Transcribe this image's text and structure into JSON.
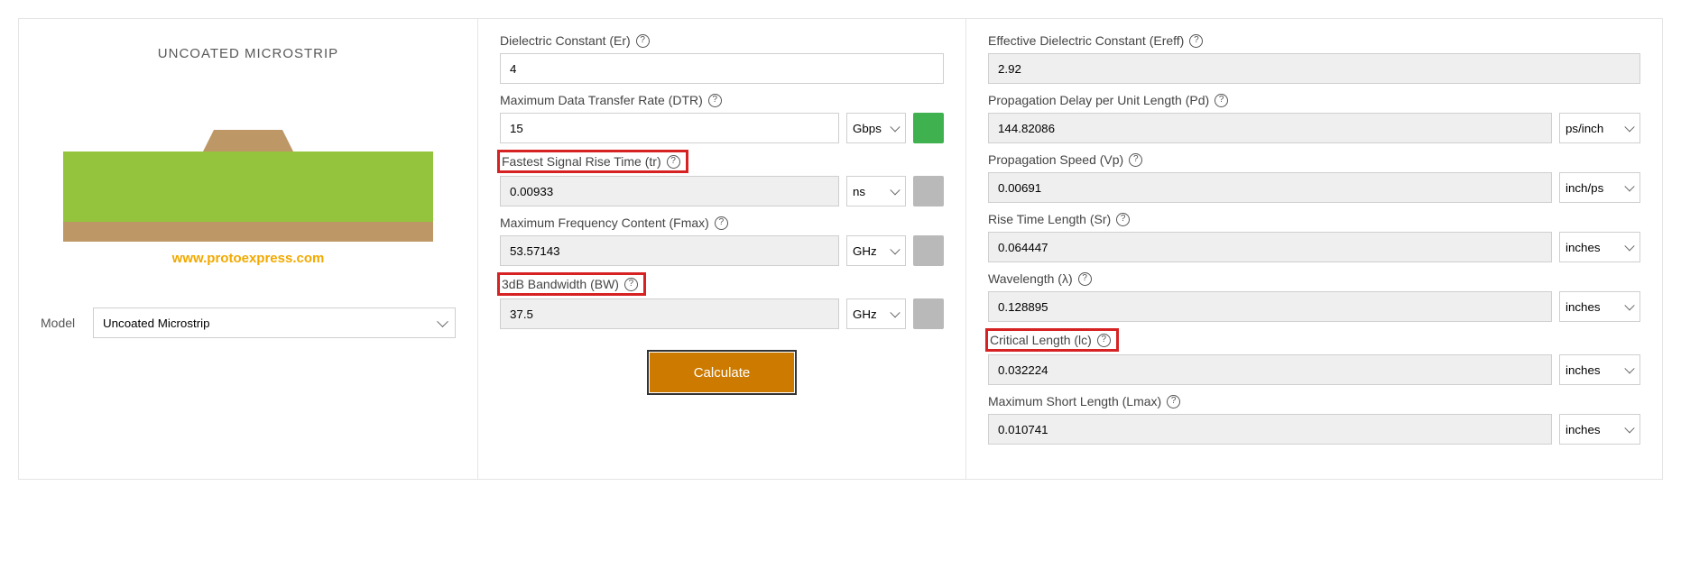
{
  "title": "UNCOATED MICROSTRIP",
  "diagram_url": "www.protoexpress.com",
  "model_label": "Model",
  "model_value": "Uncoated Microstrip",
  "calculate_label": "Calculate",
  "inputs": {
    "er": {
      "label": "Dielectric Constant (Er)",
      "value": "4"
    },
    "dtr": {
      "label": "Maximum Data Transfer Rate (DTR)",
      "value": "15",
      "unit": "Gbps",
      "status": "ok"
    },
    "tr": {
      "label": "Fastest Signal Rise Time (tr)",
      "value": "0.00933",
      "unit": "ns",
      "status": "none",
      "readonly": true
    },
    "fmax": {
      "label": "Maximum Frequency Content (Fmax)",
      "value": "53.57143",
      "unit": "GHz",
      "status": "none",
      "readonly": true
    },
    "bw": {
      "label": "3dB Bandwidth (BW)",
      "value": "37.5",
      "unit": "GHz",
      "status": "none",
      "readonly": true
    }
  },
  "outputs": {
    "ereff": {
      "label": "Effective Dielectric Constant (Ereff)",
      "value": "2.92"
    },
    "pd": {
      "label": "Propagation Delay per Unit Length (Pd)",
      "value": "144.82086",
      "unit": "ps/inch"
    },
    "vp": {
      "label": "Propagation Speed (Vp)",
      "value": "0.00691",
      "unit": "inch/ps"
    },
    "sr": {
      "label": "Rise Time Length (Sr)",
      "value": "0.064447",
      "unit": "inches"
    },
    "lambda": {
      "label": "Wavelength (λ)",
      "value": "0.128895",
      "unit": "inches"
    },
    "lc": {
      "label": "Critical Length (lc)",
      "value": "0.032224",
      "unit": "inches"
    },
    "lmax": {
      "label": "Maximum Short Length (Lmax)",
      "value": "0.010741",
      "unit": "inches"
    }
  }
}
